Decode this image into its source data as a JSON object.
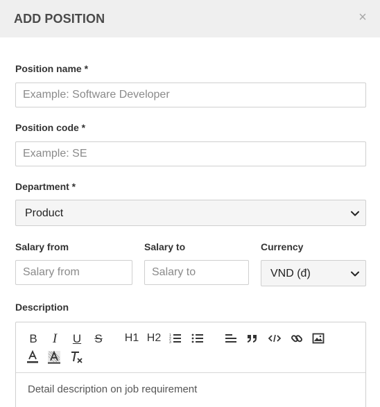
{
  "modal": {
    "title": "ADD POSITION",
    "close_symbol": "×"
  },
  "form": {
    "position_name": {
      "label": "Position name *",
      "placeholder": "Example: Software Developer",
      "value": ""
    },
    "position_code": {
      "label": "Position code *",
      "placeholder": "Example: SE",
      "value": ""
    },
    "department": {
      "label": "Department *",
      "selected": "Product"
    },
    "salary_from": {
      "label": "Salary from",
      "placeholder": "Salary from",
      "value": ""
    },
    "salary_to": {
      "label": "Salary to",
      "placeholder": "Salary to",
      "value": ""
    },
    "currency": {
      "label": "Currency",
      "selected": "VND (đ)"
    },
    "description": {
      "label": "Description",
      "placeholder": "Detail description on job requirement",
      "toolbar": {
        "bold": "B",
        "italic": "I",
        "underline": "U",
        "strike": "S",
        "h1": "H1",
        "h2": "H2"
      }
    }
  },
  "icons": {
    "close": "close-icon",
    "chevron": "chevron-down-icon",
    "toolbar": [
      "bold-icon",
      "italic-icon",
      "underline-icon",
      "strikethrough-icon",
      "heading-1-icon",
      "heading-2-icon",
      "ordered-list-icon",
      "bullet-list-icon",
      "align-icon",
      "blockquote-icon",
      "code-icon",
      "link-icon",
      "image-icon",
      "font-color-icon",
      "background-color-icon",
      "clear-format-icon"
    ]
  }
}
